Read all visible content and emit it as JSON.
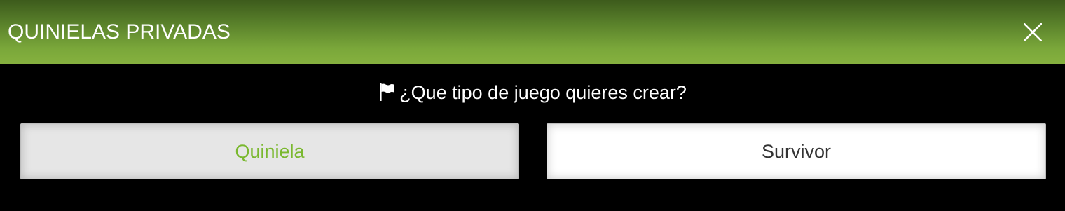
{
  "modal": {
    "title": "QUINIELAS PRIVADAS",
    "close_icon": "close-icon"
  },
  "prompt": {
    "icon": "flag-icon",
    "text": "¿Que tipo de juego quieres crear?"
  },
  "options": [
    {
      "label": "Quiniela",
      "selected": true,
      "text_color": "#7ab82f"
    },
    {
      "label": "Survivor",
      "selected": false,
      "text_color": "#333333"
    }
  ],
  "colors": {
    "header_top": "#3d5b1c",
    "header_bottom": "#86b13f",
    "body_background": "#000000",
    "accent": "#7ab82f"
  }
}
